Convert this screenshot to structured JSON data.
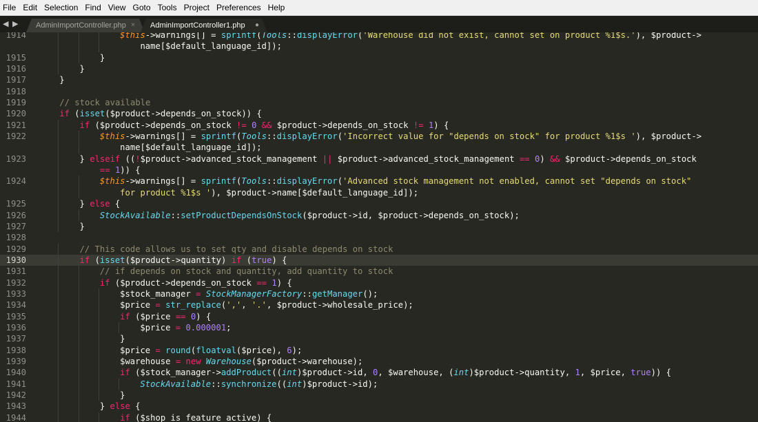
{
  "menu": [
    "File",
    "Edit",
    "Selection",
    "Find",
    "View",
    "Goto",
    "Tools",
    "Project",
    "Preferences",
    "Help"
  ],
  "tabs": [
    {
      "label": "AdminImportController.php",
      "close": "×"
    },
    {
      "label": "AdminImportController1.php",
      "dirty": "●"
    }
  ],
  "nav": "◀ ▶",
  "editor": {
    "active_line": "1930",
    "lines": [
      {
        "n": "1914",
        "i": 4,
        "t": [
          [
            "$this",
            "v"
          ],
          [
            "->warnings[] = ",
            ""
          ],
          [
            "sprintf",
            "f"
          ],
          [
            "(",
            ""
          ],
          [
            "Tools",
            "t"
          ],
          [
            "::",
            ""
          ],
          [
            "displayError",
            "f"
          ],
          [
            "(",
            ""
          ],
          [
            "'Warehouse did not exist, cannot set on product %1$s.'",
            "s"
          ],
          [
            "), $product->",
            ""
          ]
        ]
      },
      {
        "n": "",
        "i": 4,
        "t": [
          [
            "    name[$default_language_id]);",
            ""
          ]
        ]
      },
      {
        "n": "1915",
        "i": 3,
        "t": [
          [
            "}",
            ""
          ]
        ]
      },
      {
        "n": "1916",
        "i": 2,
        "t": [
          [
            "}",
            ""
          ]
        ]
      },
      {
        "n": "1917",
        "i": 1,
        "t": [
          [
            "}",
            ""
          ]
        ]
      },
      {
        "n": "1918",
        "i": 0,
        "t": []
      },
      {
        "n": "1919",
        "i": 1,
        "t": [
          [
            "// stock available",
            "c"
          ]
        ]
      },
      {
        "n": "1920",
        "i": 1,
        "t": [
          [
            "if",
            "k"
          ],
          [
            " (",
            ""
          ],
          [
            "isset",
            "f"
          ],
          [
            "($product->depends_on_stock)) {",
            ""
          ]
        ]
      },
      {
        "n": "1921",
        "i": 2,
        "t": [
          [
            "if",
            "k"
          ],
          [
            " ($product->depends_on_stock ",
            ""
          ],
          [
            "!=",
            "k"
          ],
          [
            " ",
            ""
          ],
          [
            "0",
            "n"
          ],
          [
            " ",
            ""
          ],
          [
            "&&",
            "k"
          ],
          [
            " $product->depends_on_stock ",
            ""
          ],
          [
            "!=",
            "k"
          ],
          [
            " ",
            ""
          ],
          [
            "1",
            "n"
          ],
          [
            ") {",
            ""
          ]
        ]
      },
      {
        "n": "1922",
        "i": 3,
        "t": [
          [
            "$this",
            "v"
          ],
          [
            "->warnings[] = ",
            ""
          ],
          [
            "sprintf",
            "f"
          ],
          [
            "(",
            ""
          ],
          [
            "Tools",
            "t"
          ],
          [
            "::",
            ""
          ],
          [
            "displayError",
            "f"
          ],
          [
            "(",
            ""
          ],
          [
            "'Incorrect value for \"depends on stock\" for product %1$s '",
            "s"
          ],
          [
            "), $product->",
            ""
          ]
        ]
      },
      {
        "n": "",
        "i": 3,
        "t": [
          [
            "    name[$default_language_id]);",
            ""
          ]
        ]
      },
      {
        "n": "1923",
        "i": 2,
        "t": [
          [
            "} ",
            ""
          ],
          [
            "elseif",
            "k"
          ],
          [
            " ((",
            ""
          ],
          [
            "!",
            "k"
          ],
          [
            "$product->advanced_stock_management ",
            ""
          ],
          [
            "||",
            "k"
          ],
          [
            " $product->advanced_stock_management ",
            ""
          ],
          [
            "==",
            "k"
          ],
          [
            " ",
            ""
          ],
          [
            "0",
            "n"
          ],
          [
            ") ",
            ""
          ],
          [
            "&&",
            "k"
          ],
          [
            " $product->depends_on_stock",
            ""
          ]
        ]
      },
      {
        "n": "",
        "i": 2,
        "t": [
          [
            "    ",
            ""
          ],
          [
            "==",
            "k"
          ],
          [
            " ",
            ""
          ],
          [
            "1",
            "n"
          ],
          [
            ")) {",
            ""
          ]
        ]
      },
      {
        "n": "1924",
        "i": 3,
        "t": [
          [
            "$this",
            "v"
          ],
          [
            "->warnings[] = ",
            ""
          ],
          [
            "sprintf",
            "f"
          ],
          [
            "(",
            ""
          ],
          [
            "Tools",
            "t"
          ],
          [
            "::",
            ""
          ],
          [
            "displayError",
            "f"
          ],
          [
            "(",
            ""
          ],
          [
            "'Advanced stock management not enabled, cannot set \"depends on stock\"",
            "s"
          ]
        ]
      },
      {
        "n": "",
        "i": 3,
        "t": [
          [
            "    for product %1$s '",
            "s"
          ],
          [
            "), $product->name[$default_language_id]);",
            ""
          ]
        ]
      },
      {
        "n": "1925",
        "i": 2,
        "t": [
          [
            "} ",
            ""
          ],
          [
            "else",
            "k"
          ],
          [
            " {",
            ""
          ]
        ]
      },
      {
        "n": "1926",
        "i": 3,
        "t": [
          [
            "StockAvailable",
            "t"
          ],
          [
            "::",
            ""
          ],
          [
            "setProductDependsOnStock",
            "f"
          ],
          [
            "($product->id, $product->depends_on_stock);",
            ""
          ]
        ]
      },
      {
        "n": "1927",
        "i": 2,
        "t": [
          [
            "}",
            ""
          ]
        ]
      },
      {
        "n": "1928",
        "i": 0,
        "t": []
      },
      {
        "n": "1929",
        "i": 2,
        "t": [
          [
            "// This code allows us to set qty and disable depends on stock",
            "c"
          ]
        ]
      },
      {
        "n": "1930",
        "i": 2,
        "t": [
          [
            "if",
            "k"
          ],
          [
            " (",
            ""
          ],
          [
            "isset",
            "f"
          ],
          [
            "($product->quantity) ",
            ""
          ],
          [
            "if",
            "k"
          ],
          [
            " (",
            ""
          ],
          [
            "true",
            "n"
          ],
          [
            ") {",
            ""
          ]
        ]
      },
      {
        "n": "1931",
        "i": 3,
        "t": [
          [
            "// if depends on stock and quantity, add quantity to stock",
            "c"
          ]
        ]
      },
      {
        "n": "1932",
        "i": 3,
        "t": [
          [
            "if",
            "k"
          ],
          [
            " ($product->depends_on_stock ",
            ""
          ],
          [
            "==",
            "k"
          ],
          [
            " ",
            ""
          ],
          [
            "1",
            "n"
          ],
          [
            ") {",
            ""
          ]
        ]
      },
      {
        "n": "1933",
        "i": 4,
        "t": [
          [
            "$stock_manager ",
            ""
          ],
          [
            "=",
            "k"
          ],
          [
            " ",
            ""
          ],
          [
            "StockManagerFactory",
            "t"
          ],
          [
            "::",
            ""
          ],
          [
            "getManager",
            "f"
          ],
          [
            "();",
            ""
          ]
        ]
      },
      {
        "n": "1934",
        "i": 4,
        "t": [
          [
            "$price ",
            ""
          ],
          [
            "=",
            "k"
          ],
          [
            " ",
            ""
          ],
          [
            "str_replace",
            "f"
          ],
          [
            "(",
            ""
          ],
          [
            "','",
            "s"
          ],
          [
            ", ",
            ""
          ],
          [
            "'.'",
            "s"
          ],
          [
            ", $product->wholesale_price);",
            ""
          ]
        ]
      },
      {
        "n": "1935",
        "i": 4,
        "t": [
          [
            "if",
            "k"
          ],
          [
            " ($price ",
            ""
          ],
          [
            "==",
            "k"
          ],
          [
            " ",
            ""
          ],
          [
            "0",
            "n"
          ],
          [
            ") {",
            ""
          ]
        ]
      },
      {
        "n": "1936",
        "i": 5,
        "t": [
          [
            "$price ",
            ""
          ],
          [
            "=",
            "k"
          ],
          [
            " ",
            ""
          ],
          [
            "0.000001",
            "n"
          ],
          [
            ";",
            ""
          ]
        ]
      },
      {
        "n": "1937",
        "i": 4,
        "t": [
          [
            "}",
            ""
          ]
        ]
      },
      {
        "n": "1938",
        "i": 4,
        "t": [
          [
            "$price ",
            ""
          ],
          [
            "=",
            "k"
          ],
          [
            " ",
            ""
          ],
          [
            "round",
            "f"
          ],
          [
            "(",
            ""
          ],
          [
            "floatval",
            "f"
          ],
          [
            "($price), ",
            ""
          ],
          [
            "6",
            "n"
          ],
          [
            ");",
            ""
          ]
        ]
      },
      {
        "n": "1939",
        "i": 4,
        "t": [
          [
            "$warehouse ",
            ""
          ],
          [
            "=",
            "k"
          ],
          [
            " ",
            ""
          ],
          [
            "new",
            "k"
          ],
          [
            " ",
            ""
          ],
          [
            "Warehouse",
            "t"
          ],
          [
            "($product->warehouse);",
            ""
          ]
        ]
      },
      {
        "n": "1940",
        "i": 4,
        "t": [
          [
            "if",
            "k"
          ],
          [
            " ($stock_manager->",
            ""
          ],
          [
            "addProduct",
            "f"
          ],
          [
            "((",
            ""
          ],
          [
            "int",
            "t"
          ],
          [
            ")$product->id, ",
            ""
          ],
          [
            "0",
            "n"
          ],
          [
            ", $warehouse, (",
            ""
          ],
          [
            "int",
            "t"
          ],
          [
            ")$product->quantity, ",
            ""
          ],
          [
            "1",
            "n"
          ],
          [
            ", $price, ",
            ""
          ],
          [
            "true",
            "n"
          ],
          [
            ")) {",
            ""
          ]
        ]
      },
      {
        "n": "1941",
        "i": 5,
        "t": [
          [
            "StockAvailable",
            "t"
          ],
          [
            "::",
            ""
          ],
          [
            "synchronize",
            "f"
          ],
          [
            "((",
            ""
          ],
          [
            "int",
            "t"
          ],
          [
            ")$product->id);",
            ""
          ]
        ]
      },
      {
        "n": "1942",
        "i": 4,
        "t": [
          [
            "}",
            ""
          ]
        ]
      },
      {
        "n": "1943",
        "i": 3,
        "t": [
          [
            "} ",
            ""
          ],
          [
            "else",
            "k"
          ],
          [
            " {",
            ""
          ]
        ]
      },
      {
        "n": "1944",
        "i": 4,
        "t": [
          [
            "if",
            "k"
          ],
          [
            " ($shop_is_feature_active) {",
            ""
          ]
        ]
      }
    ]
  }
}
